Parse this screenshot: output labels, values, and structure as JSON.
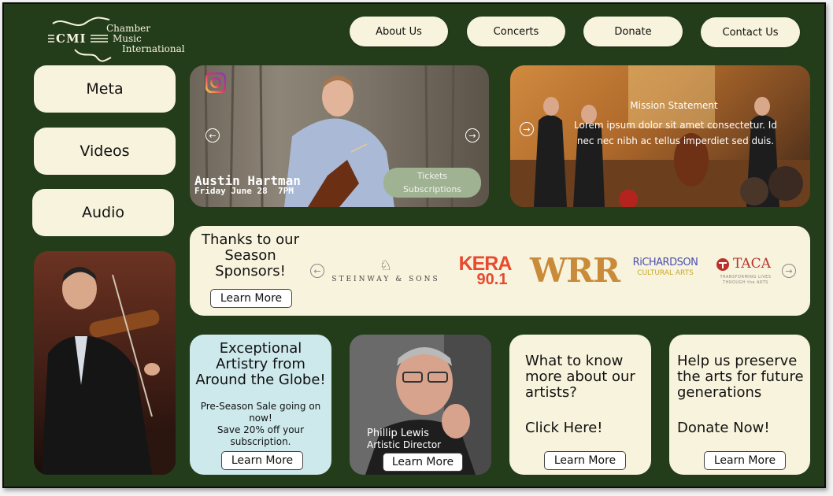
{
  "logo": {
    "abbr": "CMI",
    "line1": "Chamber",
    "line2": "Music",
    "line3": "International"
  },
  "nav": {
    "about": "About Us",
    "concerts": "Concerts",
    "donate": "Donate",
    "contact": "Contact Us"
  },
  "sidebar": {
    "items": [
      {
        "label": "Meta"
      },
      {
        "label": "Videos"
      },
      {
        "label": "Audio"
      }
    ]
  },
  "hero": {
    "performer": "Austin Hartman",
    "date": "Friday June 28  7PM",
    "tickets_line1": "Tickets",
    "tickets_line2": "Subscriptions"
  },
  "mission": {
    "title": "Mission Statement",
    "text": "Lorem ipsum dolor sit amet consectetur. Id nec nec nibh ac tellus imperdiet sed duis."
  },
  "sponsors": {
    "heading_line1": "Thanks to our",
    "heading_line2": "Season",
    "heading_line3": "Sponsors!",
    "learn_more": "Learn More",
    "steinway": "STEINWAY & SONS",
    "kera_top": "KERA",
    "kera_bottom": "90.1",
    "wrr": "WRR",
    "richardson_top": "RiCHARDSON",
    "richardson_bottom": "CULTURAL ARTS",
    "taca_name": "TACA",
    "taca_tagline": "TRANSFORMING LIVES THROUGH the ARTS"
  },
  "promo": {
    "heading": "Exceptional Artistry from Around the Globe!",
    "line1": "Pre-Season Sale going on now!",
    "line2": "Save 20% off your subscription.",
    "learn_more": "Learn More"
  },
  "director": {
    "name": "Phillip Lewis",
    "title": "Artistic Director",
    "learn_more": "Learn More"
  },
  "artists": {
    "heading": "What to know more about our artists?",
    "cta": "Click Here!",
    "learn_more": "Learn More"
  },
  "donate_card": {
    "heading": "Help us preserve the arts for future generations",
    "cta": "Donate Now!",
    "learn_more": "Learn More"
  },
  "colors": {
    "background": "#233d1b",
    "cream": "#f7f3dc",
    "promo": "#cde9ec",
    "tickets": "#9fb291",
    "kera": "#e8492f",
    "wrr": "#c98a3a",
    "richardson": "#4a4fb0",
    "taca": "#b8322a"
  }
}
